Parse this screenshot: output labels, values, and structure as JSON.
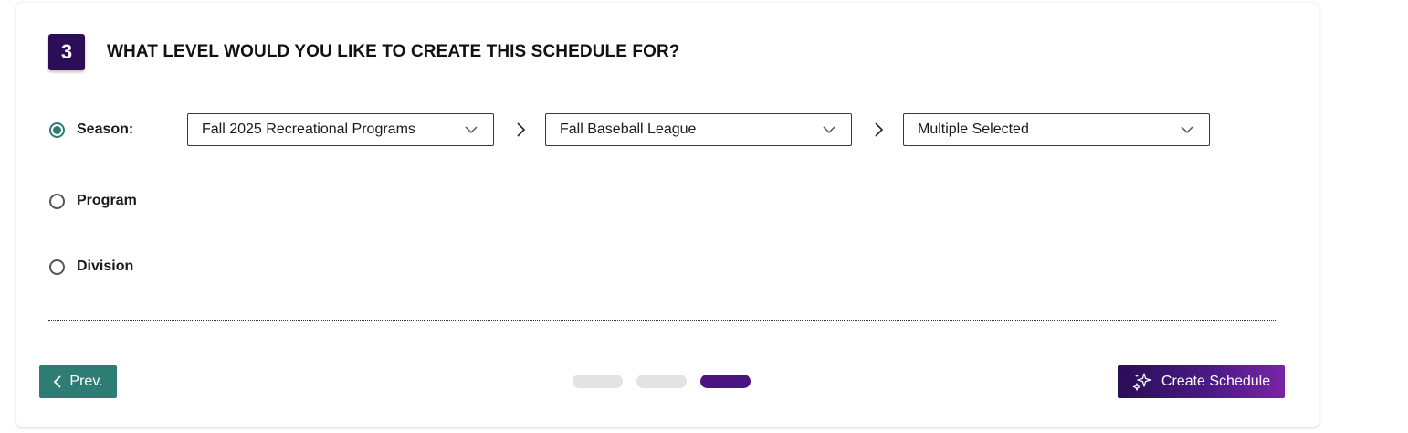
{
  "step": {
    "number": "3",
    "title": "WHAT LEVEL WOULD YOU LIKE TO CREATE THIS SCHEDULE FOR?"
  },
  "levels": [
    {
      "label": "Season:",
      "selected": true
    },
    {
      "label": "Program",
      "selected": false
    },
    {
      "label": "Division",
      "selected": false
    }
  ],
  "selects": {
    "season": "Fall 2025 Recreational Programs",
    "program": "Fall Baseball League",
    "division": "Multiple Selected"
  },
  "footer": {
    "prev_label": "Prev.",
    "create_label": "Create Schedule",
    "pager": {
      "total": 3,
      "current": 3
    }
  },
  "colors": {
    "badge": "#2b0e57",
    "teal": "#2e7d74",
    "pager_active": "#4a1580",
    "pager_inactive": "#e3e3e3"
  },
  "icons": [
    "chevron-down-icon",
    "chevron-right-icon",
    "chevron-left-icon",
    "sparkles-icon"
  ]
}
